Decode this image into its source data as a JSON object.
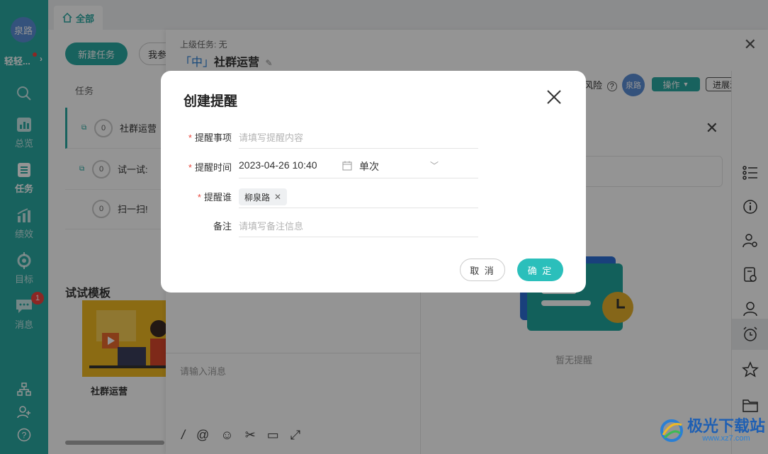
{
  "sidebar": {
    "avatar": "泉路",
    "username": "轻轻...",
    "items": [
      {
        "label": "",
        "icon": "search-icon"
      },
      {
        "label": "总览",
        "icon": "chart-icon"
      },
      {
        "label": "任务",
        "icon": "task-list-icon"
      },
      {
        "label": "绩效",
        "icon": "bar-chart-icon"
      },
      {
        "label": "目标",
        "icon": "target-icon"
      },
      {
        "label": "消息",
        "icon": "message-icon",
        "badge": "1"
      }
    ]
  },
  "tabbar": {
    "tab_all": "全部"
  },
  "tasklist": {
    "new_button": "新建任务",
    "mine_button": "我参",
    "header": "任务",
    "rows": [
      {
        "count": "0",
        "text": "社群运营"
      },
      {
        "count": "0",
        "text": "试一试: "
      },
      {
        "count": "0",
        "text": "扫一扫! "
      }
    ],
    "template_title": "试试模板",
    "template_name": "社群运营"
  },
  "drawer": {
    "parent": "上级任务: 无",
    "priority": "「中」",
    "title": "社群运营",
    "risk": "风险",
    "avatar": "泉路",
    "operate": "操作",
    "report": "进展汇报",
    "chat_placeholder": "请输入消息",
    "empty_reminder": "暂无提醒"
  },
  "modal": {
    "title": "创建提醒",
    "item_label": "提醒事项",
    "item_placeholder": "请填写提醒内容",
    "time_label": "提醒时间",
    "time_value": "2023-04-26 10:40",
    "frequency": "单次",
    "who_label": "提醒谁",
    "who_tag": "柳泉路",
    "note_label": "备注",
    "note_placeholder": "请填写备注信息",
    "cancel": "取 消",
    "ok": "确 定"
  },
  "watermark": {
    "text": "极光下载站",
    "url": "www.xz7.com"
  },
  "colors": {
    "accent": "#2aa9a3",
    "primary_button": "#2bbfbb",
    "required": "#e8473d"
  }
}
